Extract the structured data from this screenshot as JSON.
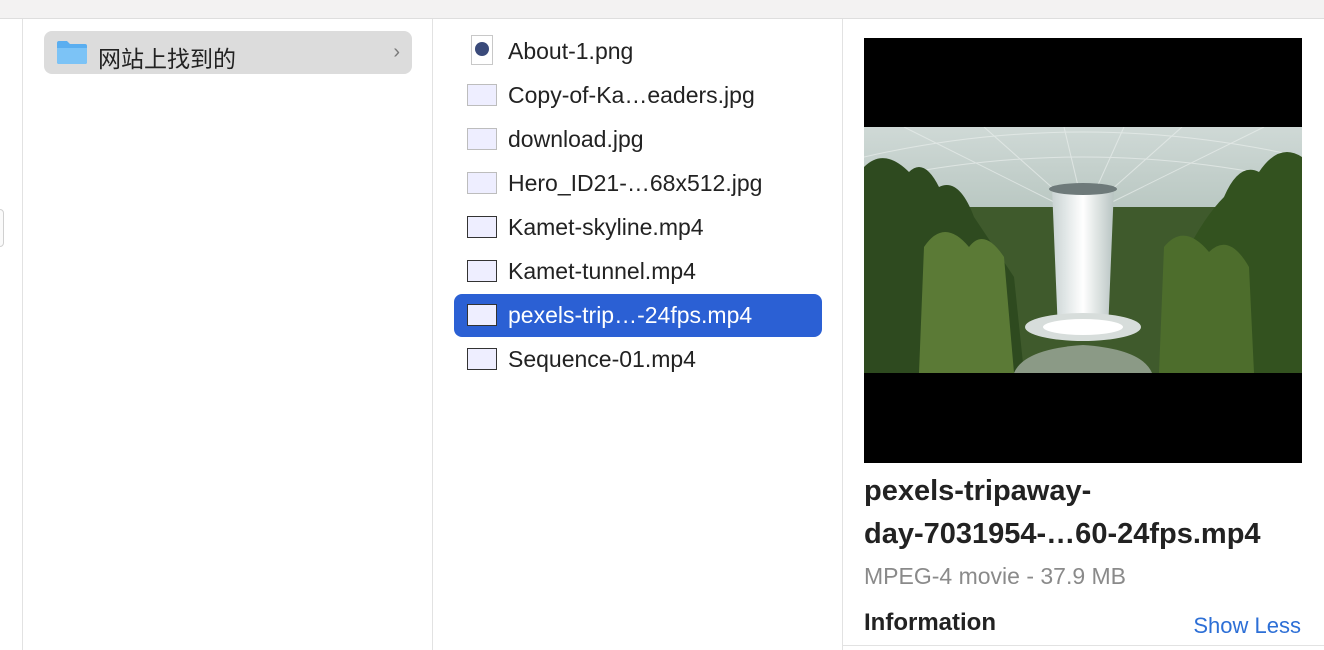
{
  "sidebar_folder": {
    "label": "网站上找到的",
    "icon": "folder-icon",
    "chevron": "›"
  },
  "files": [
    {
      "name": "About-1.png",
      "kind": "png"
    },
    {
      "name": "Copy-of-Ka…eaders.jpg",
      "kind": "jpg"
    },
    {
      "name": "download.jpg",
      "kind": "jpg"
    },
    {
      "name": "Hero_ID21-…68x512.jpg",
      "kind": "jpg"
    },
    {
      "name": "Kamet-skyline.mp4",
      "kind": "mp4"
    },
    {
      "name": "Kamet-tunnel.mp4",
      "kind": "mp4"
    },
    {
      "name": "pexels-trip…-24fps.mp4",
      "kind": "mp4",
      "selected": true
    },
    {
      "name": "Sequence-01.mp4",
      "kind": "mp4"
    }
  ],
  "preview": {
    "name_line1": "pexels-tripaway-",
    "name_line2": "day-7031954-…60-24fps.mp4",
    "kind_size": "MPEG-4 movie - 37.9 MB",
    "info_heading": "Information",
    "show_less": "Show Less"
  },
  "colors": {
    "selection": "#2b60d4",
    "link": "#2d6fd6",
    "folder_row": "#dcdcdc"
  }
}
